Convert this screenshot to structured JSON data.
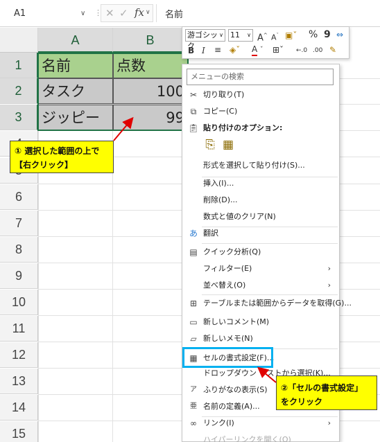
{
  "formula_bar": {
    "name_box": "A1",
    "fx_label": "fx",
    "content": "名前"
  },
  "sheet": {
    "columns": [
      "A",
      "B"
    ],
    "rows": [
      "1",
      "2",
      "3",
      "4",
      "5",
      "6",
      "7",
      "8",
      "9",
      "10",
      "11",
      "12",
      "13",
      "14",
      "15"
    ],
    "cells": {
      "a1": "名前",
      "b1": "点数",
      "a2": "タスク",
      "b2": "100",
      "a3": "ジッピー",
      "b3": "99"
    }
  },
  "mini_toolbar": {
    "font": "游ゴシック",
    "size": "11",
    "bold": "B",
    "italic": "I",
    "percent": "%",
    "comma": "9",
    "font_color_letter": "A"
  },
  "context_menu": {
    "search_placeholder": "メニューの検索",
    "items": {
      "cut": "切り取り(T)",
      "copy": "コピー(C)",
      "paste_options": "貼り付けのオプション:",
      "paste_special": "形式を選択して貼り付け(S)...",
      "insert": "挿入(I)...",
      "delete": "削除(D)...",
      "clear": "数式と値のクリア(N)",
      "translate": "翻訳",
      "quick_analysis": "クイック分析(Q)",
      "filter": "フィルター(E)",
      "sort": "並べ替え(O)",
      "get_data": "テーブルまたは範囲からデータを取得(G)...",
      "new_comment": "新しいコメント(M)",
      "new_note": "新しいメモ(N)",
      "format_cells": "セルの書式設定(F)...",
      "dropdown": "ドロップダウン リストから選択(K)...",
      "furigana": "ふりがなの表示(S)",
      "define_name": "名前の定義(A)...",
      "link": "リンク(I)",
      "hyperlink": "ハイパーリンクを開く(O)"
    }
  },
  "callouts": {
    "step1_line1": "① 選択した範囲の上で",
    "step1_line2": "【右クリック】",
    "step2_line1": "②「セルの書式設定」",
    "step2_line2": "をクリック"
  },
  "colors": {
    "header_fill": "#a9d18e",
    "data_fill": "#c9c9c9",
    "callout_fill": "#ffff00",
    "highlight_border": "#00b0f0",
    "arrow": "#e00000"
  }
}
